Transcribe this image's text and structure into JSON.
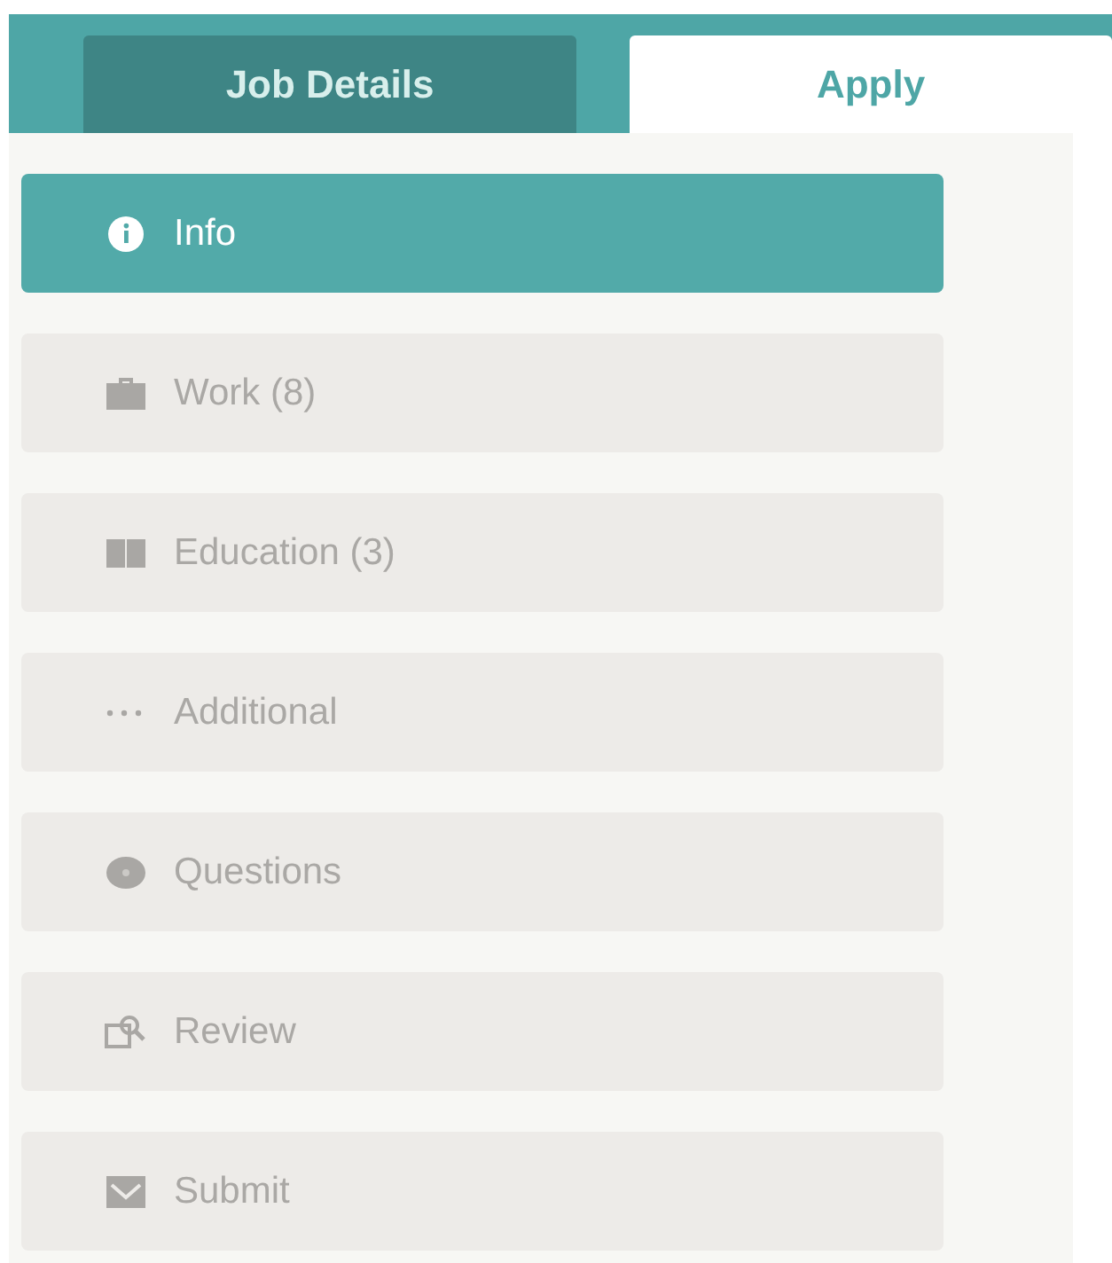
{
  "tabs": [
    {
      "label": "Job Details",
      "selected": false
    },
    {
      "label": "Apply",
      "selected": true
    }
  ],
  "steps": [
    {
      "label": "Info",
      "kind": "info",
      "selected": true
    },
    {
      "label": "Work (8)",
      "kind": "work",
      "selected": false
    },
    {
      "label": "Education (3)",
      "kind": "education",
      "selected": false
    },
    {
      "label": "Additional",
      "kind": "additional",
      "selected": false
    },
    {
      "label": "Questions",
      "kind": "questions",
      "selected": false
    },
    {
      "label": "Review",
      "kind": "review",
      "selected": false
    },
    {
      "label": "Submit",
      "kind": "submit",
      "selected": false
    }
  ]
}
